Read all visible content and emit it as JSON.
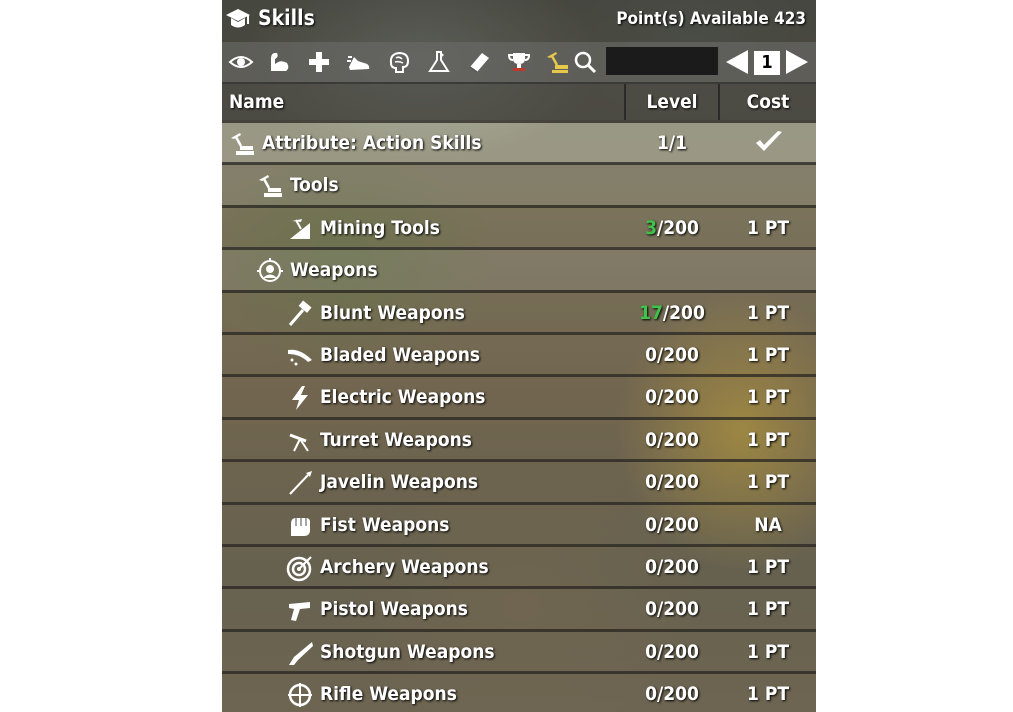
{
  "title": "Skills",
  "points_label": "Point(s) Available 423",
  "toolbar": {
    "icons": [
      "eye-icon",
      "muscle-icon",
      "plus-icon",
      "sneaker-icon",
      "brain-icon",
      "flask-icon",
      "book-icon",
      "trophy-icon",
      "tools-icon",
      "search-icon"
    ],
    "search_value": "",
    "page": "1"
  },
  "columns": {
    "name": "Name",
    "level": "Level",
    "cost": "Cost"
  },
  "rows": [
    {
      "type": "attr",
      "name": "Attribute: Action Skills",
      "level_cur": "",
      "level_max": "1/1",
      "cost": "",
      "icon": "action-skills-icon"
    },
    {
      "type": "cat",
      "name": "Tools",
      "level_cur": "",
      "level_max": "",
      "cost": "",
      "icon": "tools-icon"
    },
    {
      "type": "skill",
      "name": "Mining Tools",
      "level_cur": "3",
      "level_max": "/200",
      "cost": "1 PT",
      "icon": "mining-icon"
    },
    {
      "type": "cat",
      "name": "Weapons",
      "level_cur": "",
      "level_max": "",
      "cost": "",
      "icon": "weapons-icon"
    },
    {
      "type": "skill",
      "name": "Blunt Weapons",
      "level_cur": "17",
      "level_max": "/200",
      "cost": "1 PT",
      "icon": "hammer-icon"
    },
    {
      "type": "skill",
      "name": "Bladed Weapons",
      "level_cur": "",
      "level_max": "0/200",
      "cost": "1 PT",
      "icon": "blade-icon"
    },
    {
      "type": "skill",
      "name": "Electric Weapons",
      "level_cur": "",
      "level_max": "0/200",
      "cost": "1 PT",
      "icon": "lightning-icon"
    },
    {
      "type": "skill",
      "name": "Turret Weapons",
      "level_cur": "",
      "level_max": "0/200",
      "cost": "1 PT",
      "icon": "turret-icon"
    },
    {
      "type": "skill",
      "name": "Javelin Weapons",
      "level_cur": "",
      "level_max": "0/200",
      "cost": "1 PT",
      "icon": "javelin-icon"
    },
    {
      "type": "skill",
      "name": "Fist Weapons",
      "level_cur": "",
      "level_max": "0/200",
      "cost": "NA",
      "icon": "fist-icon"
    },
    {
      "type": "skill",
      "name": "Archery Weapons",
      "level_cur": "",
      "level_max": "0/200",
      "cost": "1 PT",
      "icon": "target-icon"
    },
    {
      "type": "skill",
      "name": "Pistol Weapons",
      "level_cur": "",
      "level_max": "0/200",
      "cost": "1 PT",
      "icon": "pistol-icon"
    },
    {
      "type": "skill",
      "name": "Shotgun Weapons",
      "level_cur": "",
      "level_max": "0/200",
      "cost": "1 PT",
      "icon": "shotgun-icon"
    },
    {
      "type": "skill",
      "name": "Rifle Weapons",
      "level_cur": "",
      "level_max": "0/200",
      "cost": "1 PT",
      "icon": "crosshair-icon"
    }
  ]
}
